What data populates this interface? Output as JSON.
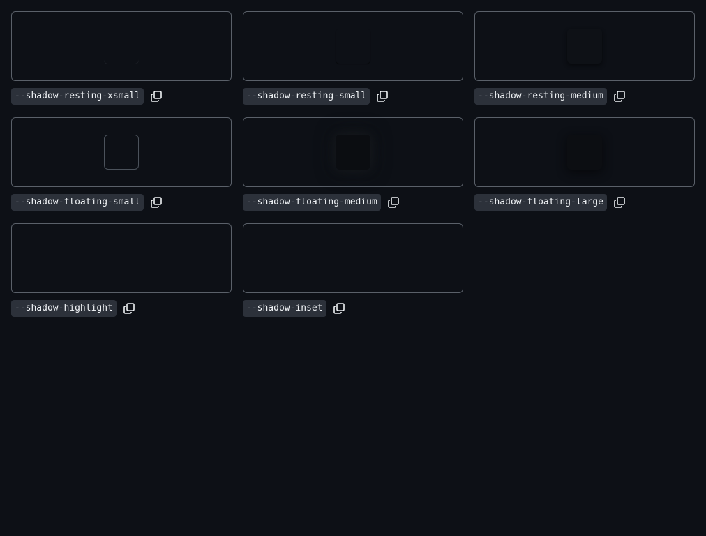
{
  "tokens": [
    {
      "name": "--shadow-resting-xsmall",
      "variant": "resting-xsmall",
      "copy_icon": "copy-icon"
    },
    {
      "name": "--shadow-resting-small",
      "variant": "resting-small",
      "copy_icon": "copy-icon"
    },
    {
      "name": "--shadow-resting-medium",
      "variant": "resting-medium",
      "copy_icon": "copy-icon"
    },
    {
      "name": "--shadow-floating-small",
      "variant": "floating-small",
      "copy_icon": "copy-icon"
    },
    {
      "name": "--shadow-floating-medium",
      "variant": "floating-medium",
      "copy_icon": "copy-icon"
    },
    {
      "name": "--shadow-floating-large",
      "variant": "floating-large",
      "copy_icon": "copy-icon"
    },
    {
      "name": "--shadow-highlight",
      "variant": "highlight",
      "copy_icon": "copy-icon"
    },
    {
      "name": "--shadow-inset",
      "variant": "inset",
      "copy_icon": "copy-icon"
    }
  ],
  "colors": {
    "background": "#0d1016",
    "card_border": "#5a6069",
    "label_background": "#2c313a",
    "label_text": "#f0f3f6",
    "icon": "#f0f3f6"
  }
}
